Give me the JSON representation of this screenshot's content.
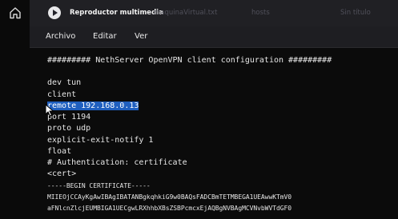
{
  "window": {
    "tabs": [
      {
        "label": "Reproductor multimedia",
        "active": true
      },
      {
        "label": "maquinaVirtual.txt",
        "active": false
      },
      {
        "label": "hosts",
        "active": false
      },
      {
        "label": "Sin título",
        "active": false
      }
    ]
  },
  "menu": {
    "items": [
      "Archivo",
      "Editar",
      "Ver"
    ]
  },
  "editor": {
    "lines": [
      "######### NethServer OpenVPN client configuration #########",
      "",
      "dev tun",
      "client",
      "remote 192.168.0.13",
      "port 1194",
      "proto udp",
      "explicit-exit-notify 1",
      "float",
      "# Authentication: certificate",
      "<cert>",
      "-----BEGIN CERTIFICATE-----",
      "MIIEOjCCAyKgAwIBAgIBATANBgkqhkiG9w0BAQsFADCBmTETMBEGA1UEAwwKTmV0",
      "aFNlcnZlcjEUMBIGA1UECgwLRXhhbXBsZSBPcmcxEjAQBgNVBAgMCVNvbWVTdGF0"
    ],
    "selected_text": "remote 192.168.0.13"
  },
  "icons": {
    "home": "home-icon",
    "app": "media-player-icon",
    "pointer": "mouse-pointer-icon"
  },
  "colors": {
    "selection": "#1f5fbf",
    "background": "#0b0b0b",
    "text": "#e6e6e6"
  }
}
